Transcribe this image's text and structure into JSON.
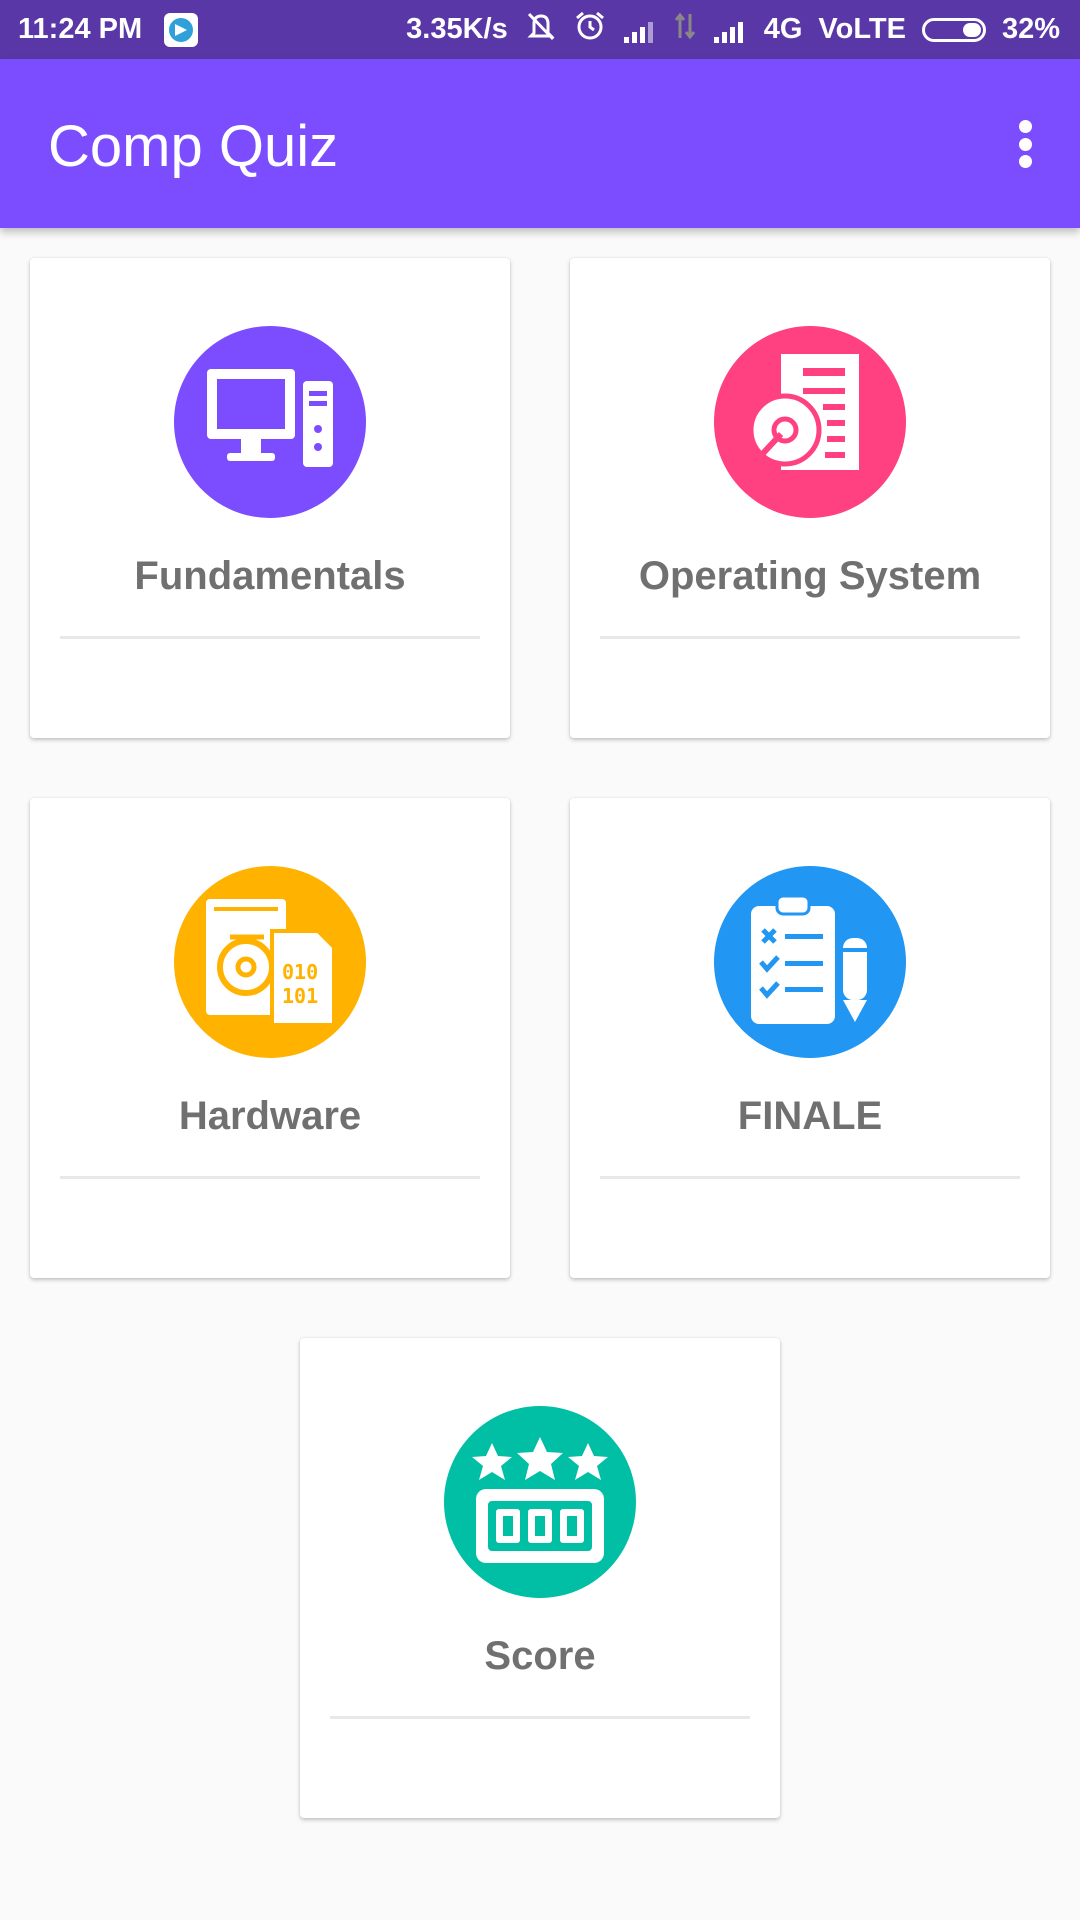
{
  "status_bar": {
    "time": "11:24 PM",
    "speed": "3.35K/s",
    "network": "4G",
    "volte": "VoLTE",
    "battery": "32%"
  },
  "app_bar": {
    "title": "Comp Quiz"
  },
  "cards": [
    {
      "label": "Fundamentals",
      "icon": "desktop-computer-icon",
      "color": "#7c4dff"
    },
    {
      "label": "Operating System",
      "icon": "os-document-disc-icon",
      "color": "#ff4081"
    },
    {
      "label": "Hardware",
      "icon": "hard-drive-binary-icon",
      "color": "#ffb300"
    },
    {
      "label": "FINALE",
      "icon": "clipboard-checklist-icon",
      "color": "#2196f3"
    },
    {
      "label": "Score",
      "icon": "star-score-counter-icon",
      "color": "#00bfa5"
    }
  ]
}
